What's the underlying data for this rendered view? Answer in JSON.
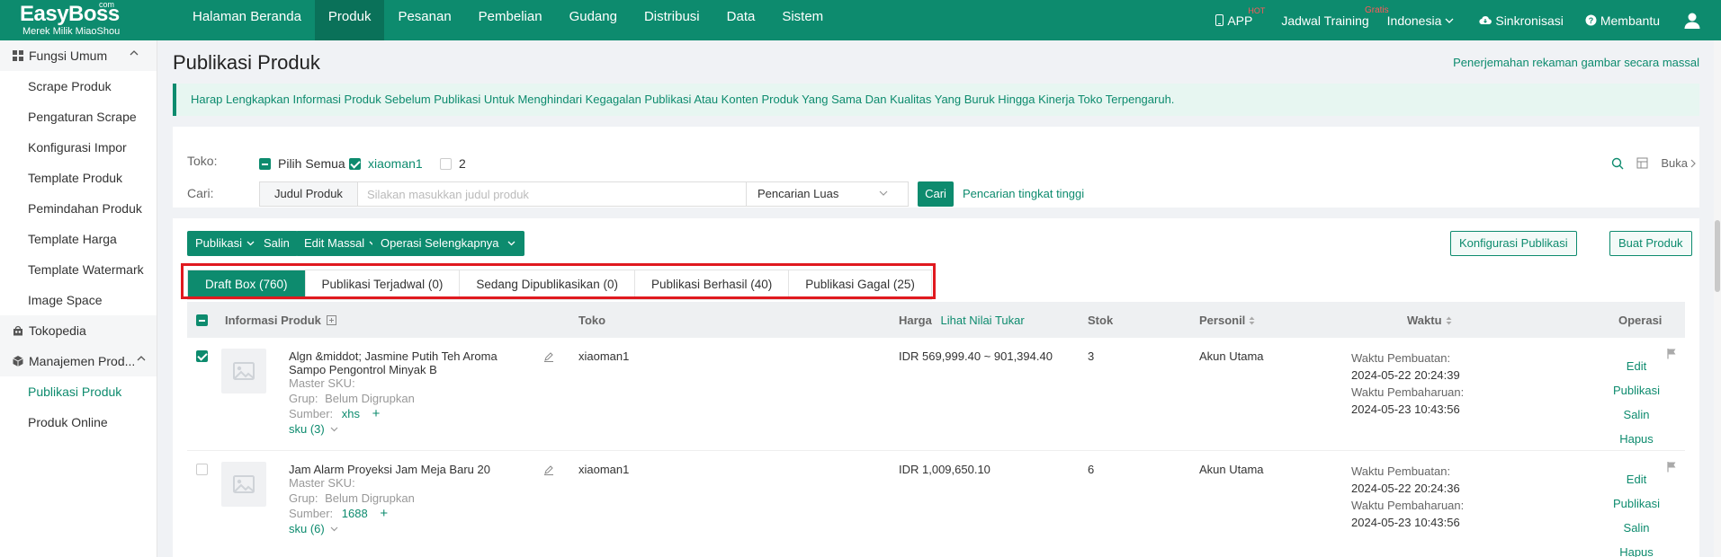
{
  "brand": {
    "name": "EasyBoss",
    "com": "com",
    "subtitle": "Merek Milik MiaoShou"
  },
  "nav": {
    "items": [
      "Halaman Beranda",
      "Produk",
      "Pesanan",
      "Pembelian",
      "Gudang",
      "Distribusi",
      "Data",
      "Sistem"
    ],
    "active": "Produk"
  },
  "topright": {
    "app": "APP",
    "app_badge": "HOT",
    "training": "Jadwal Training",
    "training_badge": "Gratis",
    "language": "Indonesia",
    "sync": "Sinkronisasi",
    "help": "Membantu"
  },
  "sidebar": {
    "group1": "Fungsi Umum",
    "group1_items": [
      "Scrape Produk",
      "Pengaturan Scrape",
      "Konfigurasi Impor",
      "Template Produk",
      "Pemindahan Produk",
      "Template Harga",
      "Template Watermark",
      "Image Space"
    ],
    "group2": "Tokopedia",
    "group3": "Manajemen Prod...",
    "group3_items": [
      "Publikasi Produk",
      "Produk Online"
    ],
    "active": "Publikasi Produk"
  },
  "page": {
    "title": "Publikasi Produk",
    "top_link": "Penerjemahan rekaman gambar secara massal",
    "notice": "Harap Lengkapkan Informasi Produk Sebelum Publikasi Untuk Menghindari Kegagalan Publikasi Atau Konten Produk Yang Sama Dan Kualitas Yang Buruk Hingga Kinerja Toko Terpengaruh."
  },
  "filter": {
    "store_label": "Toko:",
    "select_all": "Pilih Semua",
    "store1": "xiaoman1",
    "store2": "2",
    "search_label": "Cari:",
    "field": "Judul Produk",
    "placeholder": "Silakan masukkan judul produk",
    "scope": "Pencarian Luas",
    "search_button": "Cari",
    "advanced": "Pencarian tingkat tinggi",
    "expand": "Buka"
  },
  "toolbar": {
    "publish": "Publikasi",
    "copy": "Salin",
    "bulk_edit": "Edit Massal",
    "more": "Operasi Selengkapnya",
    "config": "Konfigurasi Publikasi",
    "create": "Buat Produk"
  },
  "tabs": [
    "Draft Box (760)",
    "Publikasi Terjadwal (0)",
    "Sedang Dipublikasikan (0)",
    "Publikasi Berhasil (40)",
    "Publikasi Gagal (25)"
  ],
  "table": {
    "headers": {
      "info": "Informasi Produk",
      "store": "Toko",
      "price": "Harga",
      "exchange": "Lihat Nilai Tukar",
      "stock": "Stok",
      "person": "Personil",
      "time": "Waktu",
      "ops": "Operasi"
    },
    "rows": [
      {
        "name": "Algn &middot; Jasmine Putih Teh Aroma Sampo Pengontrol Minyak B",
        "master_sku": "Master SKU:",
        "group_label": "Grup:",
        "group": "Belum Digrupkan",
        "source_label": "Sumber:",
        "source": "xhs",
        "sku": "sku (3)",
        "store": "xiaoman1",
        "price": "IDR 569,999.40 ~ 901,394.40",
        "stock": "3",
        "person": "Akun Utama",
        "created_label": "Waktu Pembuatan:",
        "created": "2024-05-22 20:24:39",
        "updated_label": "Waktu Pembaharuan:",
        "updated": "2024-05-23 10:43:56"
      },
      {
        "name": "Jam Alarm Proyeksi Jam Meja Baru 20",
        "master_sku": "Master SKU:",
        "group_label": "Grup:",
        "group": "Belum Digrupkan",
        "source_label": "Sumber:",
        "source": "1688",
        "sku": "sku (6)",
        "store": "xiaoman1",
        "price": "IDR 1,009,650.10",
        "stock": "6",
        "person": "Akun Utama",
        "created_label": "Waktu Pembuatan:",
        "created": "2024-05-22 20:24:36",
        "updated_label": "Waktu Pembaharuan:",
        "updated": "2024-05-23 10:43:56"
      }
    ],
    "ops": [
      "Edit",
      "Publikasi",
      "Salin",
      "Hapus"
    ]
  }
}
